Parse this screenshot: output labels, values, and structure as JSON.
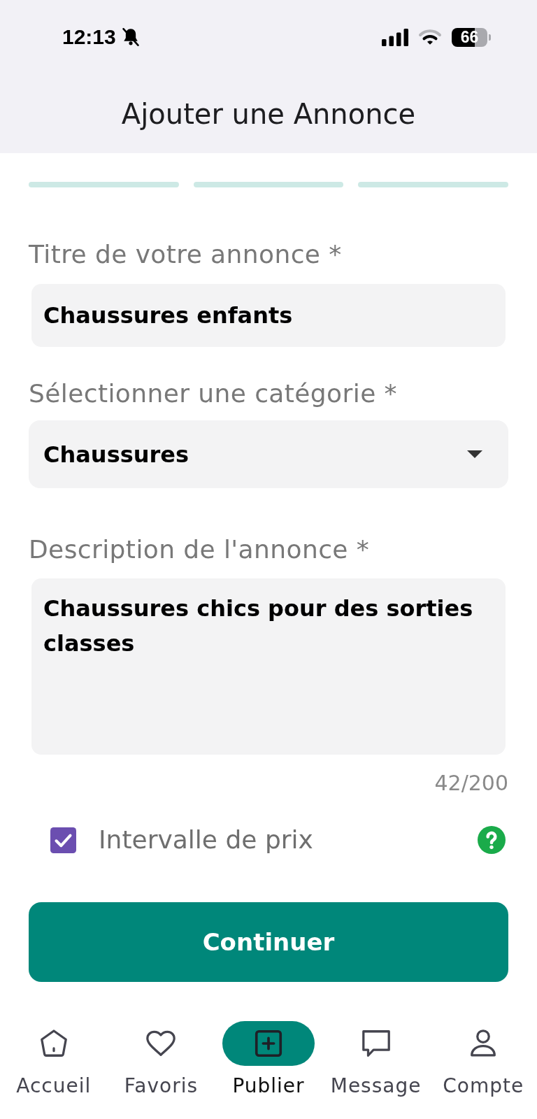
{
  "status_bar": {
    "time": "12:13",
    "battery": "66"
  },
  "header": {
    "title": "Ajouter une Annonce"
  },
  "steps": [
    {
      "completed": false
    },
    {
      "completed": false
    },
    {
      "completed": false
    }
  ],
  "form": {
    "fields": [
      {
        "kind": "text",
        "label": "Titre de votre annonce *",
        "value": "Chaussures enfants"
      },
      {
        "kind": "select",
        "label": "Sélectionner une catégorie *",
        "value": "Chaussures"
      },
      {
        "kind": "textarea",
        "label": "Description de l'annonce *",
        "value": "Chaussures chics pour des sorties classes",
        "counter": "42/200"
      }
    ],
    "price_range": {
      "label": "Intervalle de prix",
      "checked": true
    },
    "submit": "Continuer"
  },
  "nav": [
    {
      "label": "Accueil",
      "selected": false
    },
    {
      "label": "Favoris",
      "selected": false
    },
    {
      "label": "Publier",
      "selected": true
    },
    {
      "label": "Message",
      "selected": false
    },
    {
      "label": "Compte",
      "selected": false
    }
  ]
}
